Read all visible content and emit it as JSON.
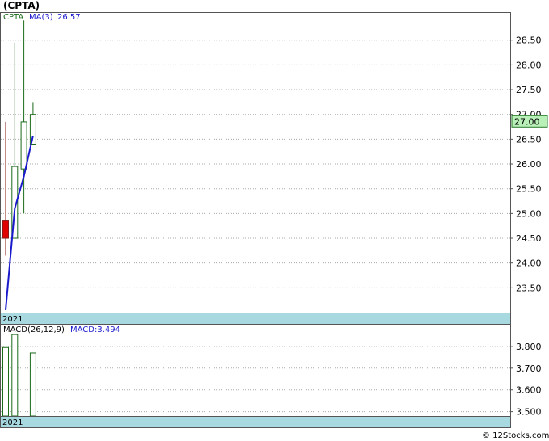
{
  "title": "(CPTA)",
  "watermark": "© 12Stocks.com",
  "colors": {
    "up": "#1a6b1a",
    "down": "#8b1a1a",
    "down_fill": "#e00000",
    "ma": "#1a1acc",
    "macd_bar": "#1a6b1a",
    "year_band": "#a8d8e0",
    "last_price_bg": "#b8f0b8"
  },
  "chart_data": [
    {
      "type": "candlestick",
      "ticker_label": "CPTA",
      "ma_label": "MA(3)",
      "ma_value": "26.57",
      "year_label": "2021",
      "last_price_label": "27.00",
      "last_price": 26.86,
      "ylim": [
        23.0,
        29.05
      ],
      "y_ticks": [
        {
          "value": 23.5,
          "label": "23.50"
        },
        {
          "value": 24.0,
          "label": "24.00"
        },
        {
          "value": 24.5,
          "label": "24.50"
        },
        {
          "value": 25.0,
          "label": "25.00"
        },
        {
          "value": 25.5,
          "label": "25.50"
        },
        {
          "value": 26.0,
          "label": "26.00"
        },
        {
          "value": 26.5,
          "label": "26.50"
        },
        {
          "value": 27.0,
          "label": "27.00"
        },
        {
          "value": 27.5,
          "label": "27.50"
        },
        {
          "value": 28.0,
          "label": "28.00"
        },
        {
          "value": 28.5,
          "label": "28.50"
        }
      ],
      "candles": [
        {
          "open": 24.85,
          "high": 26.85,
          "low": 24.15,
          "close": 24.5
        },
        {
          "open": 24.5,
          "high": 28.45,
          "low": 24.5,
          "close": 25.95
        },
        {
          "open": 25.9,
          "high": 28.9,
          "low": 25.0,
          "close": 26.85
        },
        {
          "open": 26.4,
          "high": 27.25,
          "low": 26.4,
          "close": 27.0
        }
      ],
      "ma": [
        23.05,
        25.1,
        25.75,
        26.57
      ]
    },
    {
      "type": "bar",
      "indicator_label": "MACD(26,12,9)",
      "value_label": "MACD:3.494",
      "year_label": "2021",
      "ylim": [
        3.48,
        3.9
      ],
      "y_ticks": [
        {
          "value": 3.5,
          "label": "3.500"
        },
        {
          "value": 3.6,
          "label": "3.600"
        },
        {
          "value": 3.7,
          "label": "3.700"
        },
        {
          "value": 3.8,
          "label": "3.800"
        }
      ],
      "values": [
        3.795,
        3.855,
        null,
        3.77
      ]
    }
  ]
}
